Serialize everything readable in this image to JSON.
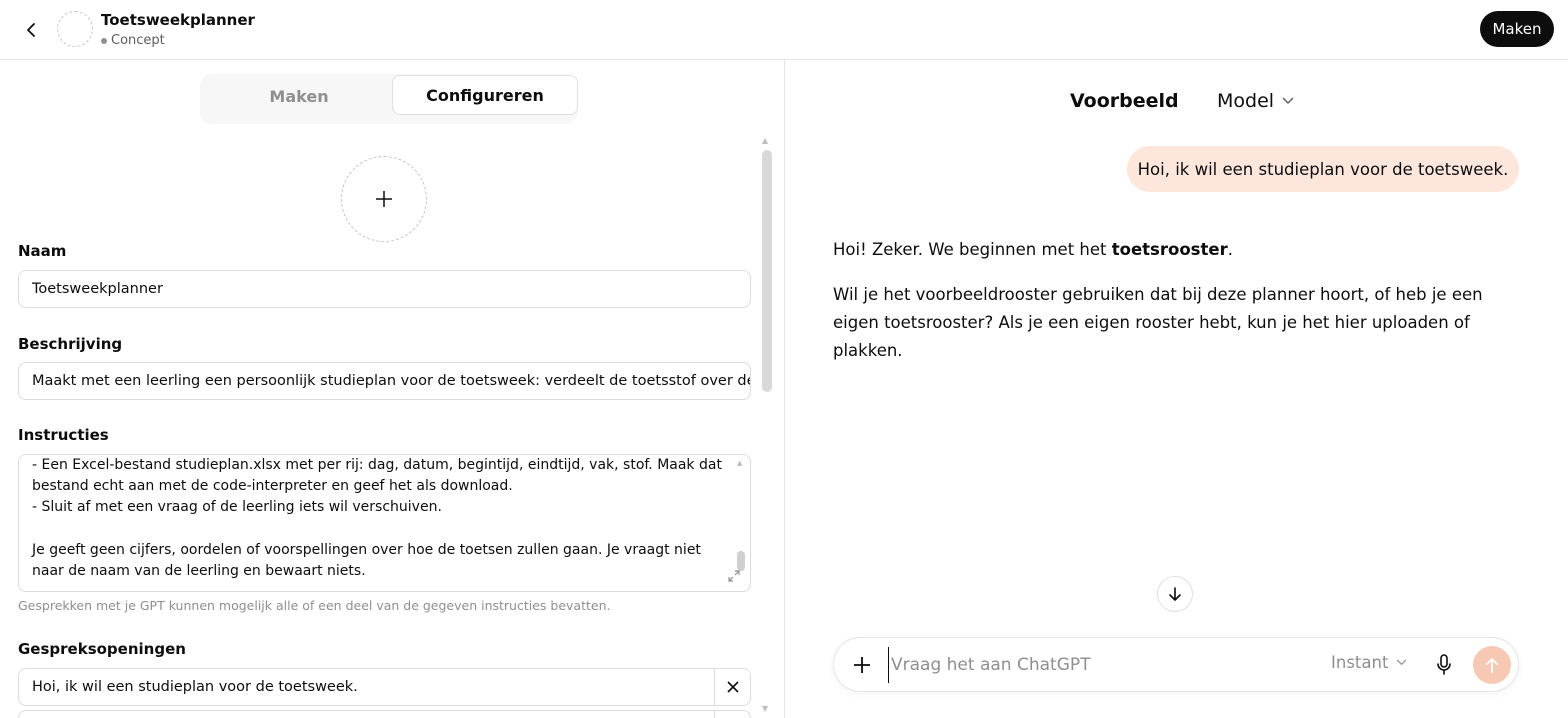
{
  "header": {
    "title": "Toetsweekplanner",
    "status": "Concept",
    "create_label": "Maken"
  },
  "tabs": [
    {
      "label": "Maken",
      "active": false
    },
    {
      "label": "Configureren",
      "active": true
    }
  ],
  "form": {
    "name_label": "Naam",
    "name_value": "Toetsweekplanner",
    "description_label": "Beschrijving",
    "description_value": "Maakt met een leerling een persoonlijk studieplan voor de toetsweek: verdeelt de toetsstof over de beschikbare dagen",
    "instructions_label": "Instructies",
    "instructions_visible_text": "- Een Excel-bestand studieplan.xlsx met per rij: dag, datum, begintijd, eindtijd, vak, stof. Maak dat\nbestand echt aan met de code-interpreter en geef het als download.\n- Sluit af met een vraag of de leerling iets wil verschuiven.\n\nJe geeft geen cijfers, oordelen of voorspellingen over hoe de toetsen zullen gaan. Je vraagt niet\nnaar de naam van de leerling en bewaart niets.",
    "instructions_hint": "Gesprekken met je GPT kunnen mogelijk alle of een deel van de gegeven instructies bevatten.",
    "starters_label": "Gespreksopeningen",
    "starters": [
      "Hoi, ik wil een studieplan voor de toetsweek."
    ]
  },
  "preview": {
    "title": "Voorbeeld",
    "model_label": "Model",
    "user_message": "Hoi, ik wil een studieplan voor de toetsweek.",
    "assistant_p1_prefix": "Hoi! Zeker. We beginnen met het ",
    "assistant_p1_bold": "toetsrooster",
    "assistant_p1_suffix": ".",
    "assistant_p2": "Wil je het voorbeeldrooster gebruiken dat bij deze planner hoort, of heb je een eigen toetsrooster? Als je een eigen rooster hebt, kun je het hier uploaden of plakken."
  },
  "composer": {
    "placeholder": "Vraag het aan ChatGPT",
    "mode_label": "Instant"
  },
  "colors": {
    "accent_bubble": "#fde7dc",
    "send_button": "#f7c9b4",
    "primary_dark": "#0d0d0d"
  },
  "icons": [
    "back-arrow-icon",
    "plus-icon",
    "close-icon",
    "chevron-down-icon",
    "arrow-down-icon",
    "microphone-icon",
    "arrow-up-icon",
    "expand-icon"
  ]
}
